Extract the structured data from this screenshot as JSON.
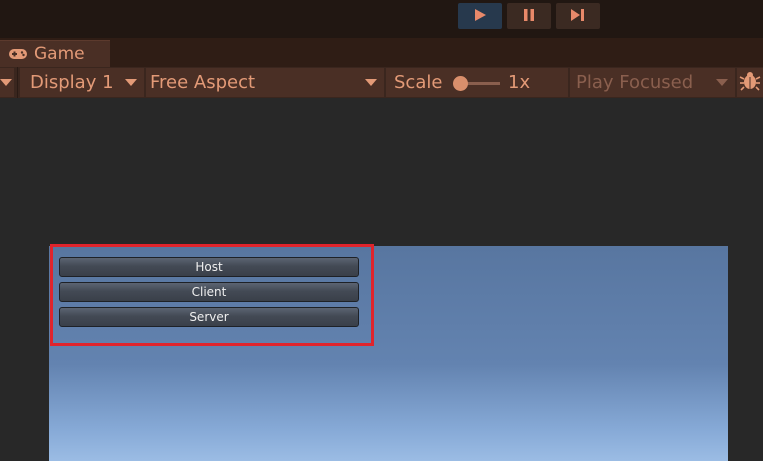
{
  "playbar": {
    "play_icon": "play-icon",
    "pause_icon": "pause-icon",
    "step_icon": "step-icon",
    "play_active": true
  },
  "tab": {
    "label": "Game",
    "icon": "gamepad-icon"
  },
  "toolbar": {
    "display": "Display 1",
    "aspect": "Free Aspect",
    "scale_label": "Scale",
    "scale_value": "1x",
    "play_mode": "Play Focused",
    "bug_icon": "bug-icon"
  },
  "buttons": {
    "host": "Host",
    "client": "Client",
    "server": "Server"
  },
  "colors": {
    "accent_text": "#e39a77",
    "toolbar_bg": "#3a261e",
    "highlight_border": "#e0242c",
    "sky_top": "#5876a0",
    "sky_bottom": "#9bbce4"
  }
}
